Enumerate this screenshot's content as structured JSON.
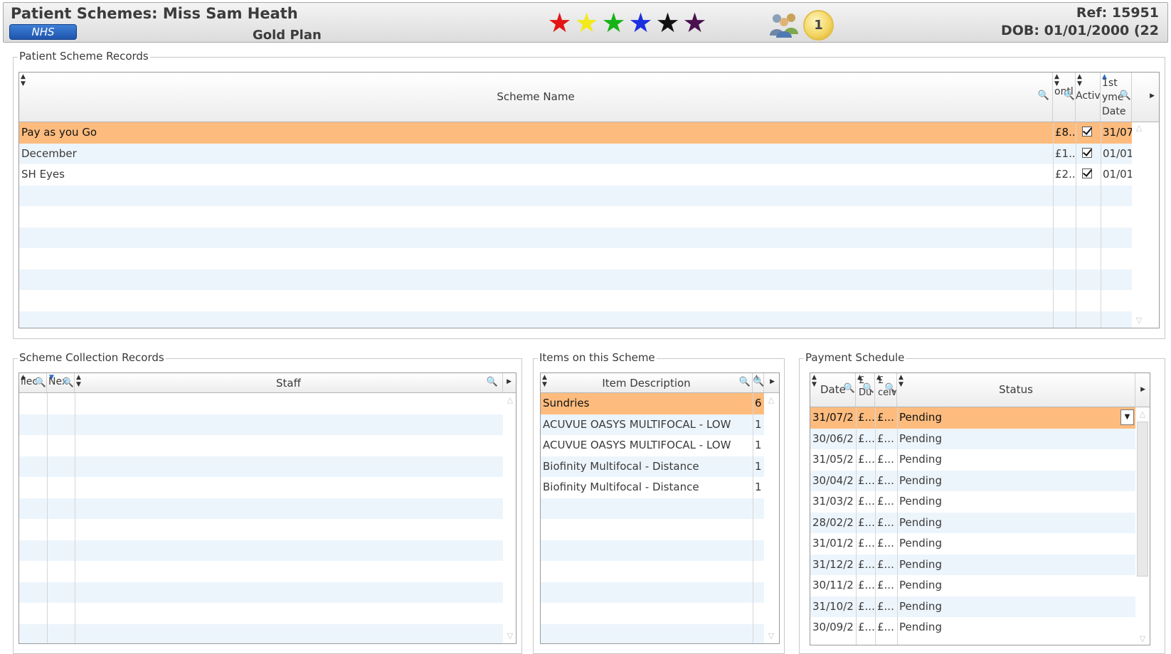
{
  "header": {
    "title": "Patient Schemes: Miss Sam Heath",
    "nhs_badge": "NHS",
    "plan": "Gold Plan",
    "stars": [
      {
        "color": "#e31515",
        "icon": "star-red-icon"
      },
      {
        "color": "#f2ea1c",
        "icon": "star-yellow-icon"
      },
      {
        "color": "#16b316",
        "icon": "star-green-icon"
      },
      {
        "color": "#1a2fe0",
        "icon": "star-blue-icon"
      },
      {
        "color": "#111111",
        "icon": "star-black-icon"
      },
      {
        "color": "#4a1050",
        "icon": "star-purple-icon"
      }
    ],
    "group_icon": "people-group-icon",
    "badge_count": "1",
    "ref": "Ref: 15951",
    "dob": "DOB: 01/01/2000 (22"
  },
  "scheme_records": {
    "label": "Patient Scheme Records",
    "columns": [
      "Scheme Name",
      "ontl\n£",
      "Active",
      "1st\nyme\nDate"
    ],
    "col_name": "Scheme Name",
    "col_amount": "ontl £",
    "col_active": "Active",
    "col_date": "1st yme Date",
    "rows": [
      {
        "name": "Pay as you Go",
        "amount": "£8...",
        "active": true,
        "date": "31/07",
        "selected": true
      },
      {
        "name": "December",
        "amount": "£1...",
        "active": true,
        "date": "01/01",
        "selected": false
      },
      {
        "name": "SH Eyes",
        "amount": "£2...",
        "active": true,
        "date": "01/01",
        "selected": false
      }
    ]
  },
  "collection_records": {
    "label": "Scheme Collection Records",
    "col_1": "llec",
    "col_2": "Nex",
    "col_staff": "Staff"
  },
  "items": {
    "label": "Items on this Scheme",
    "col_desc": "Item Description",
    "rows": [
      {
        "desc": "Sundries",
        "qty": "6",
        "selected": true
      },
      {
        "desc": "ACUVUE OASYS MULTIFOCAL - LOW",
        "qty": "1",
        "selected": false
      },
      {
        "desc": "ACUVUE OASYS MULTIFOCAL - LOW",
        "qty": "1",
        "selected": false
      },
      {
        "desc": "Biofinity Multifocal - Distance",
        "qty": "1",
        "selected": false
      },
      {
        "desc": "Biofinity Multifocal - Distance",
        "qty": "1",
        "selected": false
      }
    ]
  },
  "payment_schedule": {
    "label": "Payment Schedule",
    "col_date": "Date",
    "col_due": "£ Du",
    "col_received": "£ ceiv",
    "col_status": "Status",
    "rows": [
      {
        "date": "31/07/2",
        "due": "£...",
        "received": "£...",
        "status": "Pending",
        "selected": true
      },
      {
        "date": "30/06/2",
        "due": "£...",
        "received": "£...",
        "status": "Pending",
        "selected": false
      },
      {
        "date": "31/05/2",
        "due": "£...",
        "received": "£...",
        "status": "Pending",
        "selected": false
      },
      {
        "date": "30/04/2",
        "due": "£...",
        "received": "£...",
        "status": "Pending",
        "selected": false
      },
      {
        "date": "31/03/2",
        "due": "£...",
        "received": "£...",
        "status": "Pending",
        "selected": false
      },
      {
        "date": "28/02/2",
        "due": "£...",
        "received": "£...",
        "status": "Pending",
        "selected": false
      },
      {
        "date": "31/01/2",
        "due": "£...",
        "received": "£...",
        "status": "Pending",
        "selected": false
      },
      {
        "date": "31/12/2",
        "due": "£...",
        "received": "£...",
        "status": "Pending",
        "selected": false
      },
      {
        "date": "30/11/2",
        "due": "£...",
        "received": "£...",
        "status": "Pending",
        "selected": false
      },
      {
        "date": "31/10/2",
        "due": "£...",
        "received": "£...",
        "status": "Pending",
        "selected": false
      },
      {
        "date": "30/09/2",
        "due": "£...",
        "received": "£...",
        "status": "Pending",
        "selected": false
      }
    ]
  },
  "colors": {
    "selected_row": "#fdbc7e",
    "alt_row": "#edf5fc",
    "nhs_blue": "#1f55ad",
    "search_icon": "#2a6fd1"
  }
}
